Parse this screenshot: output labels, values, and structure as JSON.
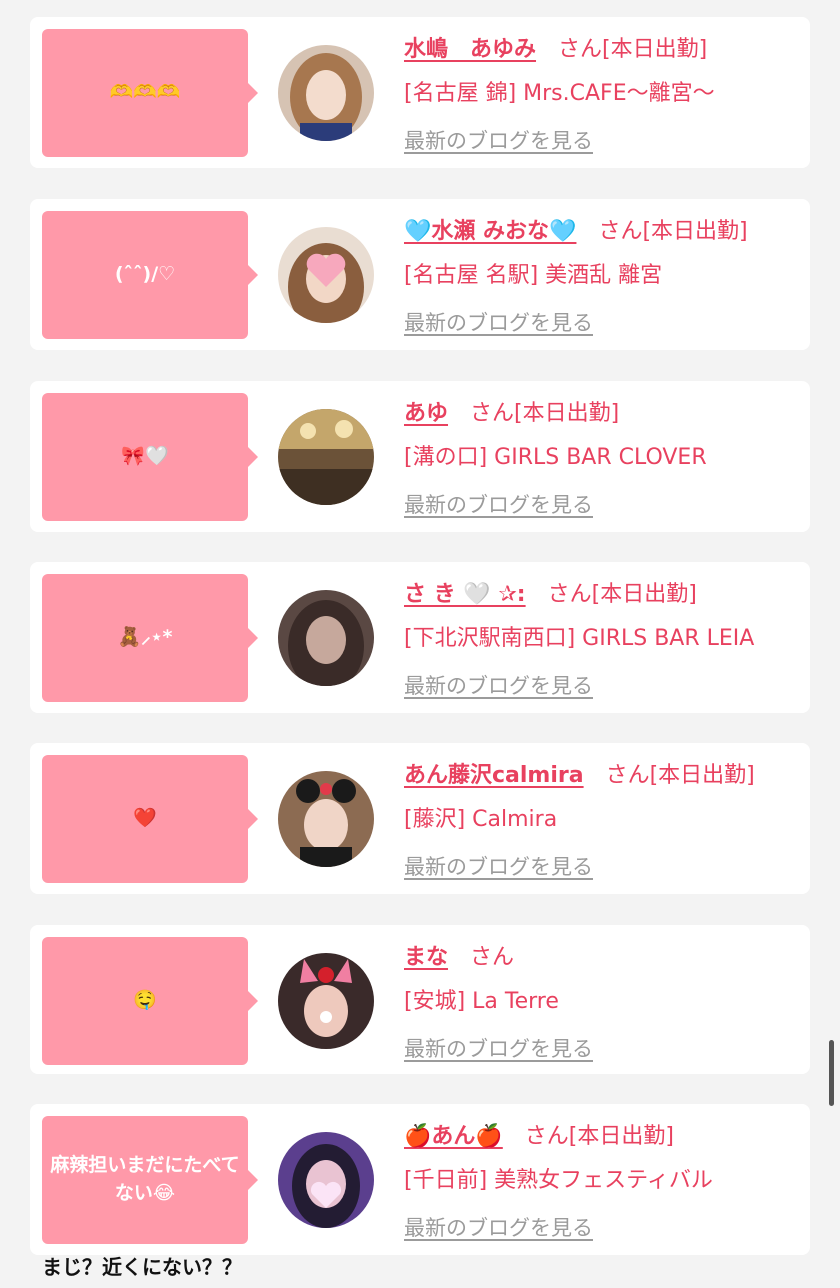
{
  "colors": {
    "background": "#f3f3f3",
    "card": "#ffffff",
    "bubble": "#ff99a9",
    "accent": "#e8415f",
    "link_gray": "#9b9b9b"
  },
  "cards": [
    {
      "bubble_text": "🫶🫶🫶",
      "name": "水嶋　あゆみ",
      "suffix": "さん[本日出勤]",
      "shop": "[名古屋 錦] Mrs.CAFE〜離宮〜",
      "blog_link": "最新のブログを見る",
      "avatar_icon": "woman-portrait-icon"
    },
    {
      "bubble_text": "(ˆˆ)/♡",
      "name": "🩵水瀬 みおな🩵",
      "suffix": "さん[本日出勤]",
      "shop": "[名古屋 名駅] 美酒乱 離宮",
      "blog_link": "最新のブログを見る",
      "avatar_icon": "heart-face-portrait-icon"
    },
    {
      "bubble_text": "🎀🤍",
      "name": "あゆ",
      "suffix": "さん[本日出勤]",
      "shop": "[溝の口] GIRLS BAR CLOVER",
      "blog_link": "最新のブログを見る",
      "avatar_icon": "chandelier-photo-icon"
    },
    {
      "bubble_text": "🧸⸝⋆*",
      "name": "さ き 🤍 ✰:",
      "suffix": "さん[本日出勤]",
      "shop": "[下北沢駅南西口] GIRLS BAR LEIA",
      "blog_link": "最新のブログを見る",
      "avatar_icon": "blurred-portrait-icon"
    },
    {
      "bubble_text": "❤️",
      "name": "あん藤沢calmira",
      "suffix": "さん[本日出勤]",
      "shop": "[藤沢] Calmira",
      "blog_link": "最新のブログを見る",
      "avatar_icon": "mouse-ears-portrait-icon"
    },
    {
      "bubble_text": "🤤",
      "name": "まな",
      "suffix": "さん",
      "shop": "[安城] La Terre",
      "blog_link": "最新のブログを見る",
      "avatar_icon": "bunny-ears-portrait-icon"
    },
    {
      "bubble_text": "麻辣担いまだにたべてない😂",
      "name": "🍎あん🍎",
      "suffix": "さん[本日出勤]",
      "shop": "[千日前] 美熟女フェスティバル",
      "blog_link": "最新のブログを見る",
      "avatar_icon": "heart-filter-portrait-icon"
    }
  ],
  "caption": "まじ？近くにない？？"
}
